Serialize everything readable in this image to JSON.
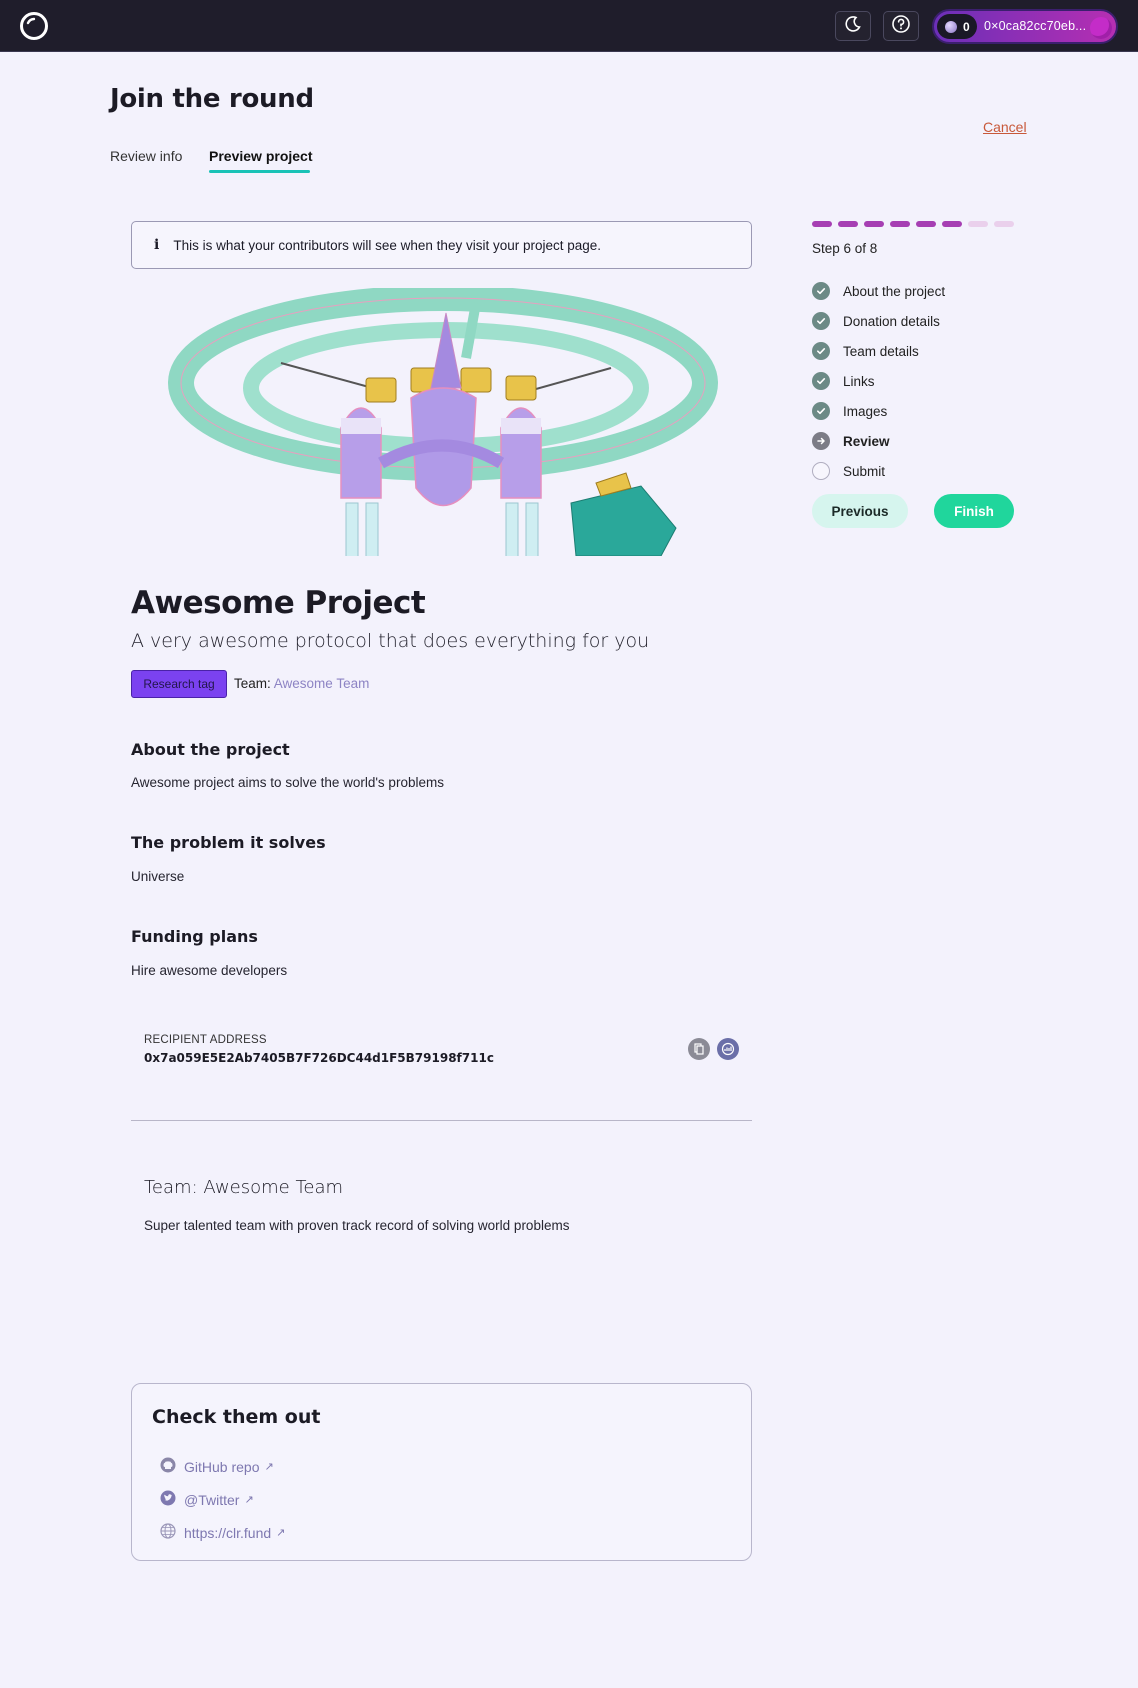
{
  "topbar": {
    "wallet_balance": "0",
    "wallet_address": "0×0ca82cc70eb...",
    "icons": [
      "logo-icon",
      "moon-icon",
      "help-icon"
    ]
  },
  "header": {
    "title": "Join the round",
    "cancel_label": "Cancel",
    "tabs": [
      {
        "label": "Review info",
        "active": false
      },
      {
        "label": "Preview project",
        "active": true
      }
    ]
  },
  "banner": {
    "icon": "info-icon",
    "text": "This is what your contributors will see when they visit your project page."
  },
  "project": {
    "title": "Awesome Project",
    "tagline": "A very awesome protocol that does everything for you",
    "tag": "Research tag",
    "team_prefix": "Team:",
    "team_name": "Awesome Team",
    "sections": [
      {
        "heading": "About the project",
        "body": "Awesome project aims to solve the world's problems"
      },
      {
        "heading": "The problem it solves",
        "body": "Universe"
      },
      {
        "heading": "Funding plans",
        "body": "Hire awesome developers"
      }
    ],
    "recipient_label": "RECIPIENT ADDRESS",
    "recipient_address": "0x7a059E5E2Ab7405B7F726DC44d1F5B79198f711c",
    "team_title": "Team: Awesome Team",
    "team_description": "Super talented team with proven track record of solving world problems",
    "links_title": "Check them out",
    "links": [
      {
        "label": "GitHub repo",
        "icon": "github-icon"
      },
      {
        "label": "@Twitter",
        "icon": "twitter-icon"
      },
      {
        "label": "https://clr.fund",
        "icon": "globe-icon"
      }
    ]
  },
  "sidebar": {
    "progress_completed": 6,
    "progress_total": 8,
    "step_text": "Step 6 of 8",
    "steps": [
      {
        "label": "About the project",
        "status": "done"
      },
      {
        "label": "Donation details",
        "status": "done"
      },
      {
        "label": "Team details",
        "status": "done"
      },
      {
        "label": "Links",
        "status": "done"
      },
      {
        "label": "Images",
        "status": "done"
      },
      {
        "label": "Review",
        "status": "current"
      },
      {
        "label": "Submit",
        "status": "todo"
      }
    ],
    "previous_label": "Previous",
    "finish_label": "Finish"
  },
  "colors": {
    "accent": "#19c2b6",
    "finish": "#20d69c",
    "progress_done": "#a63fb3",
    "tag_bg": "#7b42f0"
  }
}
